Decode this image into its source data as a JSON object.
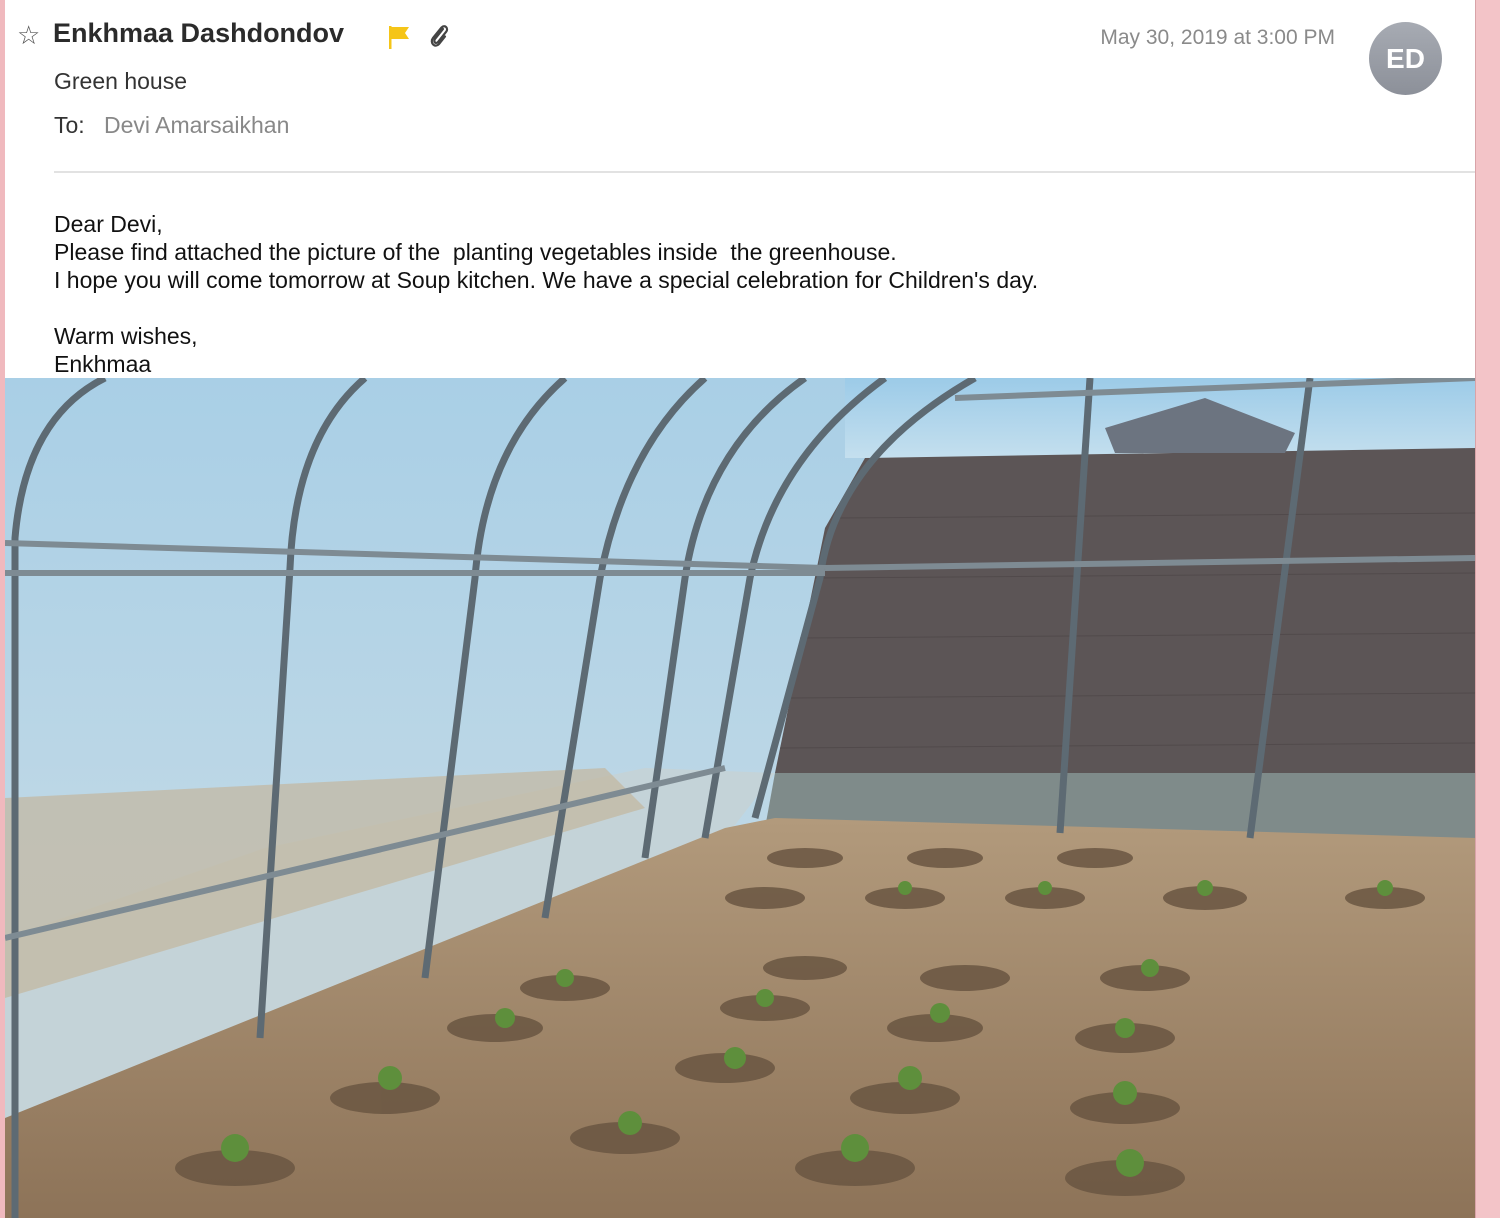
{
  "message": {
    "sender": "Enkhmaa Dashdondov",
    "date": "May 30, 2019 at 3:00 PM",
    "avatar_initials": "ED",
    "subject": "Green house",
    "to_label": "To:",
    "recipient": "Devi Amarsaikhan",
    "flag_color": "#f5c518",
    "avatar_color": "#9a9ea6"
  },
  "body": {
    "greeting": "Dear Devi,",
    "line1": "Please find attached the picture of the  planting vegetables inside  the greenhouse.",
    "line2": "I hope you will come tomorrow at Soup kitchen. We have a special celebration for Children's day.",
    "closing": "Warm wishes,",
    "signature": "Enkhmaa"
  },
  "icons": {
    "star": "star-outline-icon",
    "flag": "flag-icon",
    "attachment": "paperclip-icon"
  }
}
